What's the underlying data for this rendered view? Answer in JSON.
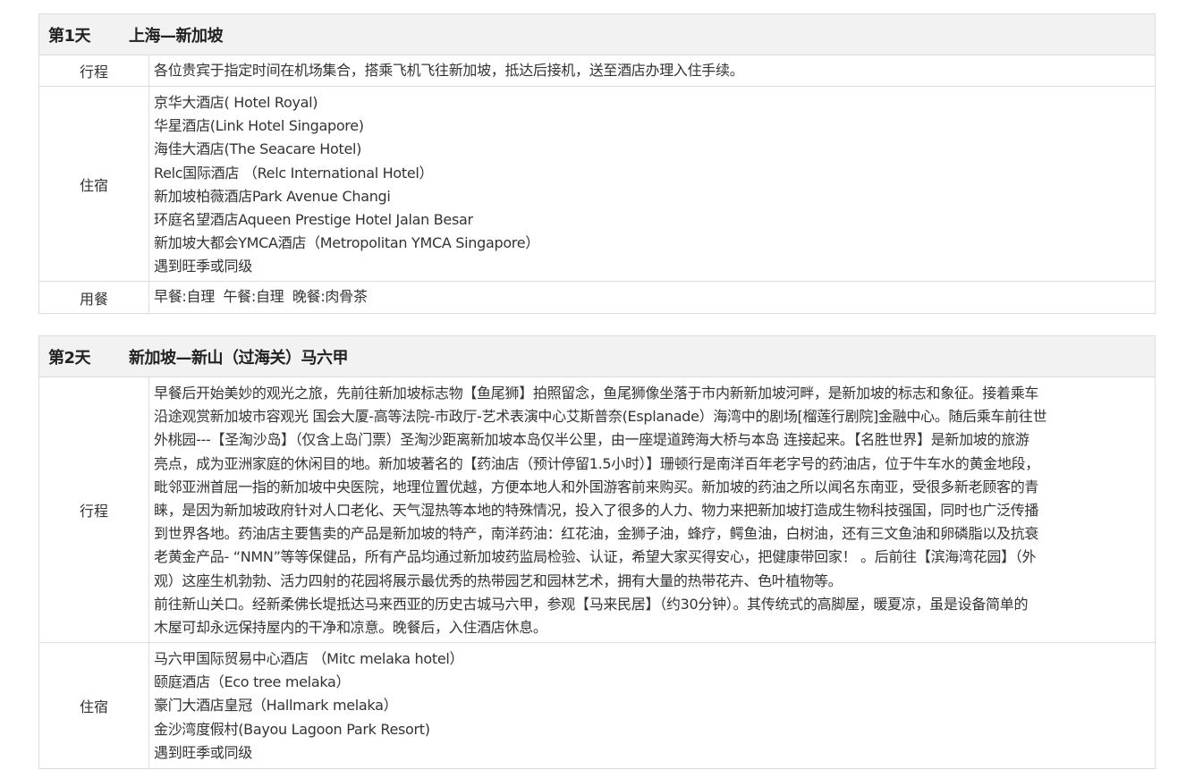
{
  "days": [
    {
      "day": "第1天",
      "route": "上海—新加坡",
      "itinerary_label": "行程",
      "itinerary": "各位贵宾于指定时间在机场集合，搭乘飞机飞往新加坡，抵达后接机，送至酒店办理入住手续。",
      "lodging_label": "住宿",
      "hotels": [
        "京华大酒店( Hotel Royal)",
        "华星酒店(Link Hotel Singapore)",
        "海佳大酒店(The Seacare Hotel)",
        "Relc国际酒店 （Relc International Hotel）",
        "新加坡柏薇酒店Park Avenue Changi",
        "环庭名望酒店Aqueen Prestige Hotel Jalan Besar",
        "新加坡大都会YMCA酒店（Metropolitan YMCA Singapore）",
        "遇到旺季或同级"
      ],
      "meals_label": "用餐",
      "meals": "早餐:自理  午餐:自理  晚餐:肉骨茶"
    },
    {
      "day": "第2天",
      "route": "新加坡—新山（过海关）马六甲",
      "itinerary_label": "行程",
      "itinerary_lines": [
        "早餐后开始美妙的观光之旅，先前往新加坡标志物【鱼尾狮】拍照留念，鱼尾狮像坐落于市内新新加坡河畔，是新加坡的标志和象征。接着乘车",
        "沿途观赏新加坡市容观光 国会大厦-高等法院-市政厅-艺术表演中心艾斯普奈(Esplanade）海湾中的剧场[榴莲行剧院]金融中心。随后乘车前往世",
        "外桃园---【圣淘沙岛】（仅含上岛门票）圣淘沙距离新加坡本岛仅半公里，由一座堤道跨海大桥与本岛 连接起来。【名胜世界】是新加坡的旅游",
        "亮点，成为亚洲家庭的休闲目的地。新加坡著名的【药油店（预计停留1.5小时）】珊顿行是南洋百年老字号的药油店，位于牛车水的黄金地段，",
        "毗邻亚洲首屈一指的新加坡中央医院，地理位置优越，方便本地人和外国游客前来购买。新加坡的药油之所以闻名东南亚，受很多新老顾客的青",
        "睐，是因为新加坡政府针对人口老化、天气湿热等本地的特殊情况，投入了很多的人力、物力来把新加坡打造成生物科技强国，同时也广泛传播",
        "到世界各地。药油店主要售卖的产品是新加坡的特产，南洋药油：红花油，金狮子油，蜂疗，鳄鱼油，白树油，还有三文鱼油和卵磷脂以及抗衰",
        "老黄金产品- “NMN”等等保健品，所有产品均通过新加坡药监局检验、认证，希望大家买得安心，把健康带回家！ 。后前往【滨海湾花园】（外",
        "观）这座生机勃勃、活力四射的花园将展示最优秀的热带园艺和园林艺术，拥有大量的热带花卉、色叶植物等。",
        "前往新山关口。经新柔佛长堤抵达马来西亚的历史古城马六甲，参观【马来民居】（约30分钟）。其传统式的高脚屋，暖夏凉，虽是设备简单的",
        "木屋可却永远保持屋内的干净和凉意。晚餐后，入住酒店休息。"
      ],
      "lodging_label": "住宿",
      "hotels": [
        "马六甲国际贸易中心酒店 （Mitc melaka hotel）",
        "颐庭酒店（Eco tree melaka）",
        "豪门大酒店皇冠（Hallmark melaka）",
        "金沙湾度假村(Bayou Lagoon Park Resort)",
        "遇到旺季或同级"
      ]
    }
  ]
}
